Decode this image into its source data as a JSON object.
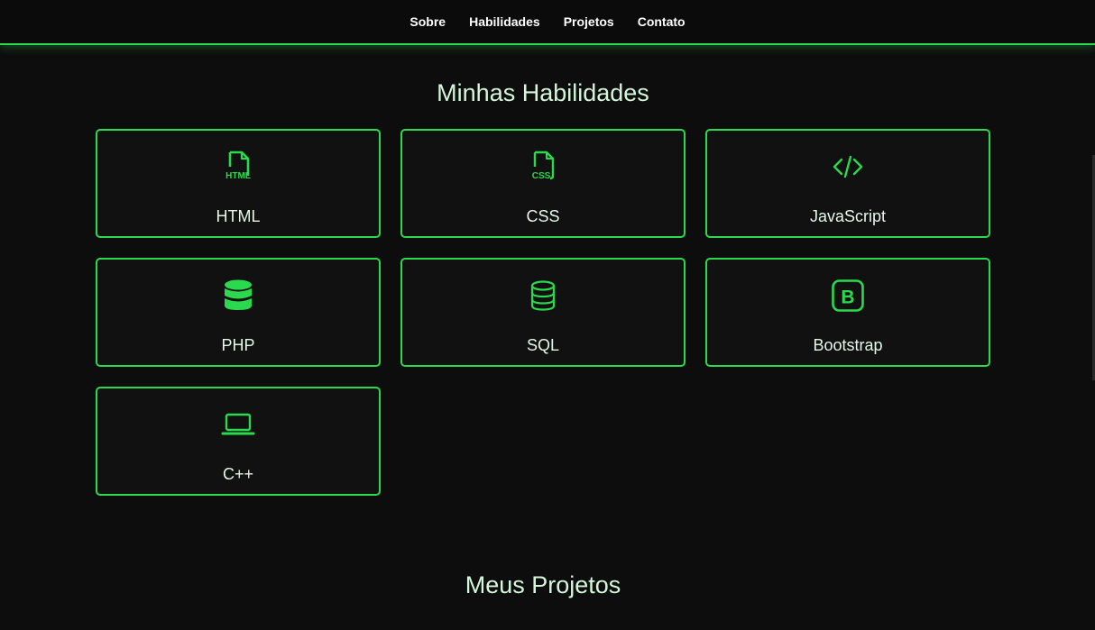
{
  "nav": {
    "items": [
      "Sobre",
      "Habilidades",
      "Projetos",
      "Contato"
    ]
  },
  "skills": {
    "title": "Minhas Habilidades",
    "items": [
      {
        "label": "HTML",
        "icon": "html-file-icon"
      },
      {
        "label": "CSS",
        "icon": "css-file-icon"
      },
      {
        "label": "JavaScript",
        "icon": "code-icon"
      },
      {
        "label": "PHP",
        "icon": "database-filled-icon"
      },
      {
        "label": "SQL",
        "icon": "database-outline-icon"
      },
      {
        "label": "Bootstrap",
        "icon": "bootstrap-icon"
      },
      {
        "label": "C++",
        "icon": "laptop-icon"
      }
    ]
  },
  "projects": {
    "title": "Meus Projetos"
  },
  "colors": {
    "accent": "#2bd94e",
    "background": "#0d0d0d",
    "card_background": "#111111"
  }
}
